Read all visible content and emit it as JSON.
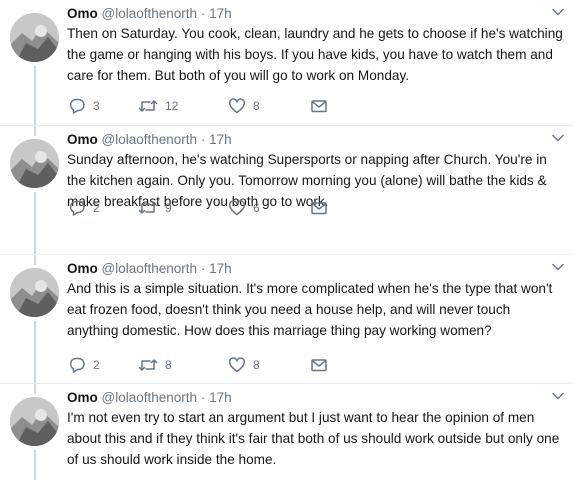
{
  "tweets": [
    {
      "name": "Omo",
      "handle": "@lolaofthenorth",
      "separator": "·",
      "time": "17h",
      "text": "Then on Saturday. You cook, clean, laundry and he gets to choose if he's watching the game or hanging with his boys. If you have kids, you have to watch them and care for them. But both of you will go to work on Monday.",
      "replies": "3",
      "retweets": "12",
      "likes": "8"
    },
    {
      "name": "Omo",
      "handle": "@lolaofthenorth",
      "separator": "·",
      "time": "17h",
      "text": "Sunday afternoon, he's watching Supersports or napping after Church. You're in the kitchen again. Only you. Tomorrow morning you (alone) will bathe the kids & make breakfast before you both go to work.",
      "replies": "2",
      "retweets": "9",
      "likes": "6"
    },
    {
      "name": "Omo",
      "handle": "@lolaofthenorth",
      "separator": "·",
      "time": "17h",
      "text": "And this is a simple situation. It's more complicated when he's the type that won't eat frozen food, doesn't think you need a house help, and will never touch anything domestic. How does this marriage thing pay working women?",
      "replies": "2",
      "retweets": "8",
      "likes": "8"
    },
    {
      "name": "Omo",
      "handle": "@lolaofthenorth",
      "separator": "·",
      "time": "17h",
      "text": "I'm not even try to start an argument but I just want to hear the opinion of men about this and if they think it's fair that both of us should work outside but only one of us should work inside the home."
    }
  ],
  "colors": {
    "text": "#14171a",
    "secondary": "#657786",
    "thread_line": "#ccd6dd",
    "divider": "#e6ecf0"
  },
  "icons": {
    "reply": "speech-bubble-icon",
    "retweet": "retweet-arrows-icon",
    "like": "heart-icon",
    "dm": "envelope-icon",
    "more": "chevron-down-icon"
  }
}
